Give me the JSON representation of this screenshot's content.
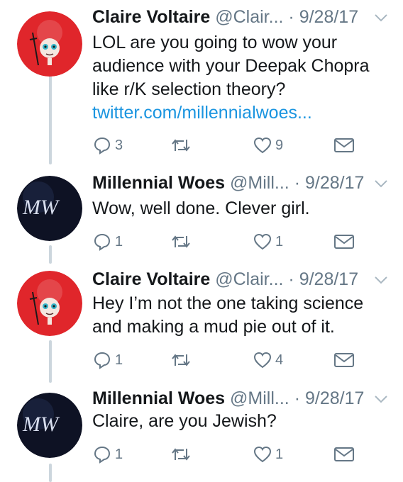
{
  "tweets": [
    {
      "author": "Claire Voltaire",
      "handle": "@Clair...",
      "separator": "·",
      "date": "9/28/17",
      "avatar_type": "claire",
      "lines": [
        "LOL are you going to wow your",
        "audience with your Deepak Chopra",
        "like r/K selection theory?"
      ],
      "link": "twitter.com/millennialwoes...",
      "replies": "3",
      "retweets": "",
      "likes": "9"
    },
    {
      "author": "Millennial Woes",
      "handle": "@Mill...",
      "separator": "·",
      "date": "9/28/17",
      "avatar_type": "mw",
      "lines": [
        "Wow, well done. Clever girl."
      ],
      "link": "",
      "replies": "1",
      "retweets": "",
      "likes": "1"
    },
    {
      "author": "Claire Voltaire",
      "handle": "@Clair...",
      "separator": "·",
      "date": "9/28/17",
      "avatar_type": "claire",
      "lines": [
        "Hey I’m not the one taking science",
        "and making a mud pie out of it."
      ],
      "link": "",
      "replies": "1",
      "retweets": "",
      "likes": "4"
    },
    {
      "author": "Millennial Woes",
      "handle": "@Mill...",
      "separator": "·",
      "date": "9/28/17",
      "avatar_type": "mw",
      "lines": [
        "Claire, are you Jewish?"
      ],
      "link": "",
      "replies": "1",
      "retweets": "",
      "likes": "1"
    }
  ],
  "avatar_text": {
    "mw": "MW"
  },
  "icons": {
    "reply": "reply-icon",
    "retweet": "retweet-icon",
    "like": "heart-icon",
    "dm": "envelope-icon",
    "caret": "chevron-down-icon"
  },
  "colors": {
    "claire_avatar": "#e0262b",
    "mw_avatar": "#0e1224",
    "link": "#1b95e0",
    "thread_line": "#ccd6dd"
  }
}
